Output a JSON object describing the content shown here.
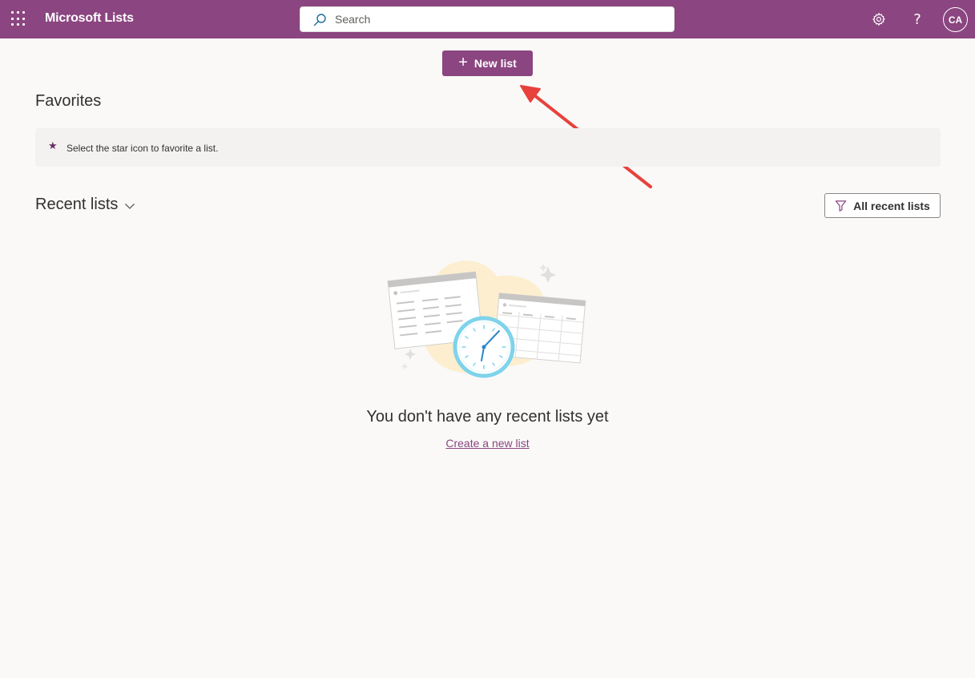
{
  "app": {
    "title": "Microsoft Lists",
    "brand_color": "#8b4580"
  },
  "header": {
    "waffle_icon": "app-launcher-icon",
    "search": {
      "placeholder": "Search",
      "value": ""
    },
    "settings_icon": "gear-icon",
    "help_icon": "help-icon",
    "help_glyph": "?",
    "avatar_initials": "CA"
  },
  "toolbar": {
    "new_list_label": "New list",
    "new_list_plus": "+"
  },
  "favorites": {
    "title": "Favorites",
    "star_glyph": "★",
    "empty_hint": "Select the star icon to favorite a list."
  },
  "recent": {
    "title": "Recent lists",
    "filter_label": "All recent lists",
    "empty_message": "You don't have any recent lists yet",
    "create_link": "Create a new list"
  }
}
